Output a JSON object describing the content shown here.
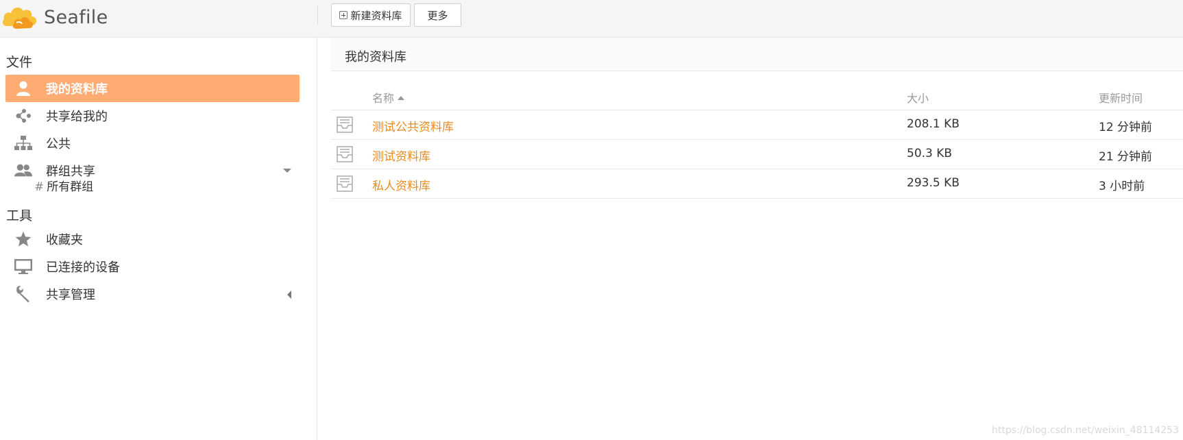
{
  "header": {
    "app_name": "Seafile",
    "new_library_label": "新建资料库",
    "more_label": "更多"
  },
  "sidebar": {
    "files_title": "文件",
    "tools_title": "工具",
    "items": [
      {
        "label": "我的资料库",
        "icon": "user-icon",
        "active": true
      },
      {
        "label": "共享给我的",
        "icon": "share-icon"
      },
      {
        "label": "公共",
        "icon": "org-icon"
      },
      {
        "label": "群组共享",
        "icon": "group-icon"
      }
    ],
    "sub_items": [
      {
        "label": "所有群组",
        "prefix": "#"
      }
    ],
    "tools": [
      {
        "label": "收藏夹",
        "icon": "star-icon"
      },
      {
        "label": "已连接的设备",
        "icon": "monitor-icon"
      },
      {
        "label": "共享管理",
        "icon": "wrench-icon"
      }
    ]
  },
  "main": {
    "title": "我的资料库",
    "columns": {
      "name": "名称",
      "size": "大小",
      "updated": "更新时间"
    },
    "rows": [
      {
        "name": "测试公共资料库",
        "size": "208.1 KB",
        "updated": "12 分钟前"
      },
      {
        "name": "测试资料库",
        "size": "50.3 KB",
        "updated": "21 分钟前"
      },
      {
        "name": "私人资料库",
        "size": "293.5 KB",
        "updated": "3 小时前"
      }
    ]
  },
  "watermark": "https://blog.csdn.net/weixin_48114253",
  "colors": {
    "accent": "#feac74",
    "link": "#ea8a1e"
  }
}
